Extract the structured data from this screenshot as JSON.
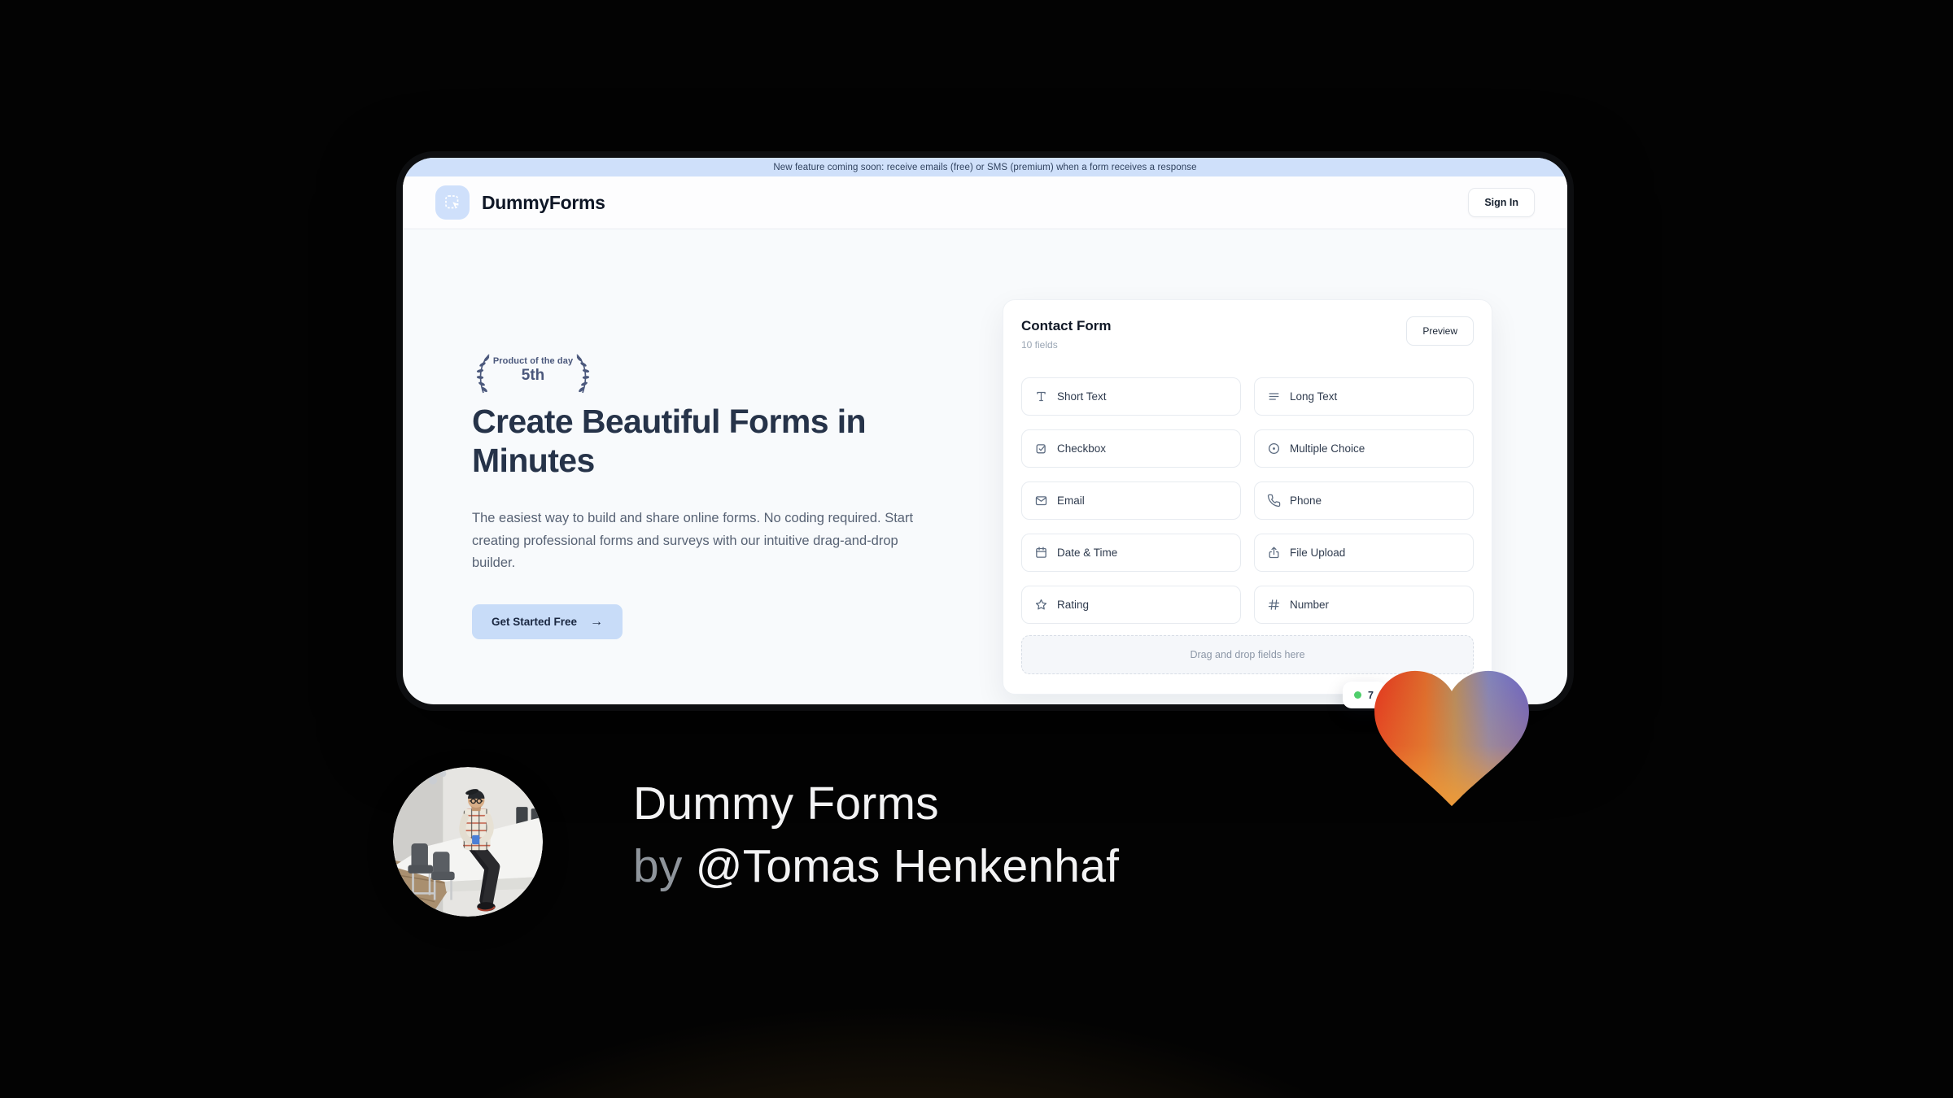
{
  "window": {
    "banner_text": "New feature coming soon: receive emails (free) or SMS (premium) when a form receives a response",
    "header": {
      "brand": "DummyForms",
      "sign_in": "Sign In"
    },
    "hero": {
      "badge_top": "Product of the day",
      "badge_rank": "5th",
      "title_line1": "Create Beautiful Forms in",
      "title_line2": "Minutes",
      "description": "The easiest way to build and share online forms. No coding required. Start creating professional forms and surveys with our intuitive drag-and-drop builder.",
      "cta": "Get Started Free",
      "cta_arrow": "→"
    },
    "form_card": {
      "title": "Contact Form",
      "field_count": "10 fields",
      "preview": "Preview",
      "fields": [
        {
          "label": "Short Text",
          "icon": "short-text-icon"
        },
        {
          "label": "Long Text",
          "icon": "long-text-icon"
        },
        {
          "label": "Checkbox",
          "icon": "checkbox-icon"
        },
        {
          "label": "Multiple Choice",
          "icon": "multiple-choice-icon"
        },
        {
          "label": "Email",
          "icon": "email-icon"
        },
        {
          "label": "Phone",
          "icon": "phone-icon"
        },
        {
          "label": "Date & Time",
          "icon": "calendar-icon"
        },
        {
          "label": "File Upload",
          "icon": "upload-icon"
        },
        {
          "label": "Rating",
          "icon": "star-icon"
        },
        {
          "label": "Number",
          "icon": "hash-icon"
        }
      ],
      "dropzone": "Drag and drop fields here",
      "status_badge": {
        "value": "7",
        "dot_color": "#4fce6b"
      }
    }
  },
  "footer": {
    "product_name": "Dummy Forms",
    "by_label": "by ",
    "author": "@Tomas Henkenhaf"
  },
  "colors": {
    "banner_bg": "#cfe0fa",
    "logo_bg": "#cfe0fb",
    "cta_bg": "#c8dcf8",
    "navy_text": "#263349",
    "wreath_navy": "#4b587c",
    "status_green": "#4fce6b",
    "heart_red": "#e1351f",
    "heart_orange": "#f09b37",
    "heart_purple": "#6a63c4"
  }
}
